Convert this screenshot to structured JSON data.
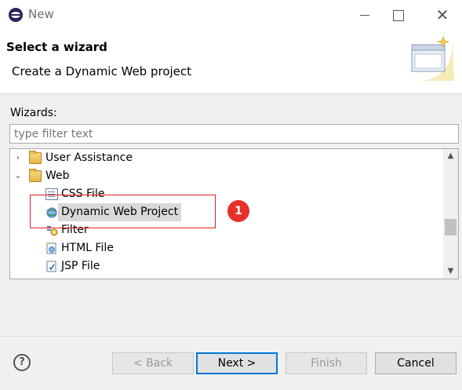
{
  "window": {
    "title": "New",
    "icon": "eclipse-icon",
    "close_glyph": "✕"
  },
  "header": {
    "title": "Select a wizard",
    "description": "Create a Dynamic Web project",
    "banner_icon": "new-wizard-banner-icon"
  },
  "wizards": {
    "label": "Wizards:",
    "filter_placeholder": "type filter text",
    "filter_value": "",
    "tree": [
      {
        "label": "User Assistance",
        "type": "folder",
        "expanded": false,
        "icon": "folder-icon"
      },
      {
        "label": "Web",
        "type": "folder",
        "expanded": true,
        "icon": "folder-icon"
      },
      {
        "label": "CSS File",
        "type": "item",
        "icon": "css-file-icon"
      },
      {
        "label": "Dynamic Web Project",
        "type": "item",
        "icon": "dynamic-web-project-icon",
        "selected": true
      },
      {
        "label": "Filter",
        "type": "item",
        "icon": "filter-icon"
      },
      {
        "label": "HTML File",
        "type": "item",
        "icon": "html-file-icon"
      },
      {
        "label": "JSP File",
        "type": "item",
        "icon": "jsp-file-icon"
      }
    ],
    "expand_glyph": "›",
    "collapse_glyph": "⌄"
  },
  "annotation": {
    "badge": "1",
    "color": "#e02020"
  },
  "footer": {
    "help_glyph": "?",
    "back_label": "< Back",
    "next_label": "Next >",
    "finish_label": "Finish",
    "cancel_label": "Cancel"
  }
}
